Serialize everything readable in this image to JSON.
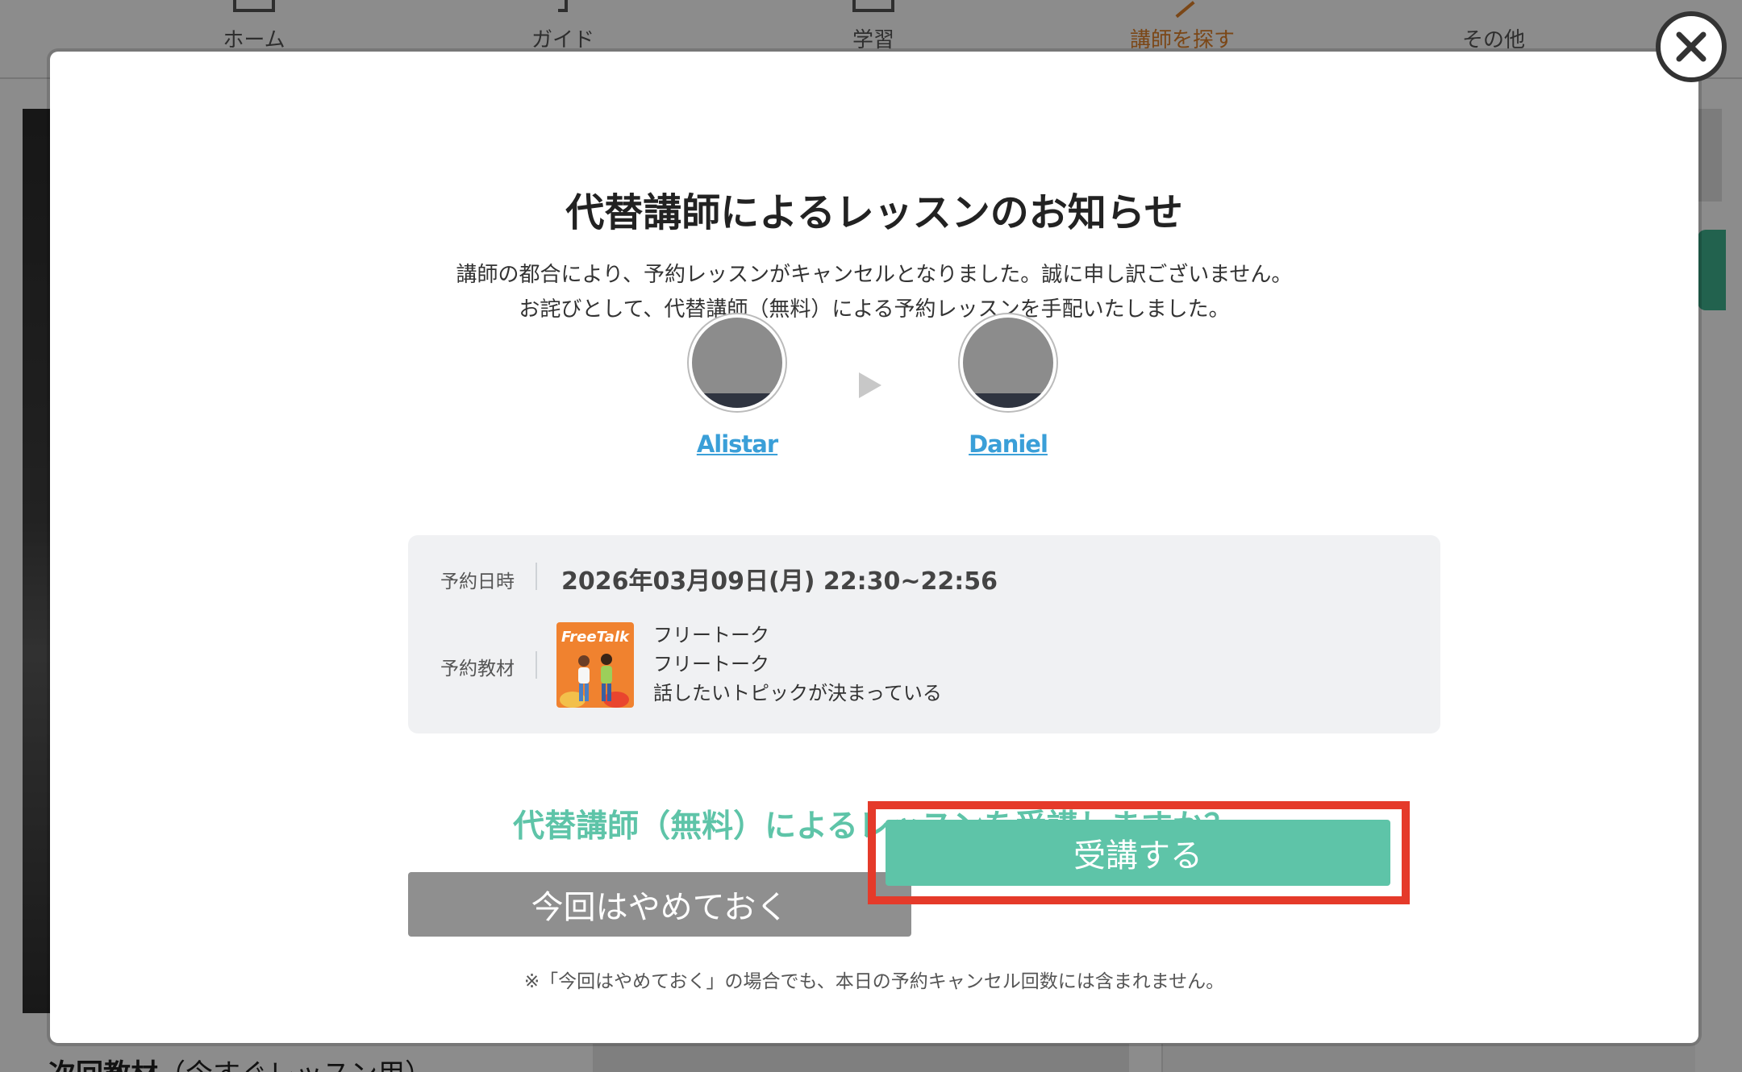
{
  "nav": {
    "items": [
      {
        "label": "ホーム",
        "icon": "home-icon"
      },
      {
        "label": "ガイド",
        "icon": "guide-icon"
      },
      {
        "label": "学習",
        "icon": "study-icon"
      },
      {
        "label": "講師を探す",
        "icon": "search-tutor-icon",
        "active": true
      },
      {
        "label": "その他",
        "icon": "more-icon"
      }
    ]
  },
  "background": {
    "bottom_title": "次回教材",
    "bottom_sub": "（今すぐレッスン用）"
  },
  "modal": {
    "title": "代替講師によるレッスンのお知らせ",
    "desc_line1": "講師の都合により、予約レッスンがキャンセルとなりました。誠に申し訳ございません。",
    "desc_line2": "お詫びとして、代替講師（無料）による予約レッスンを手配いたしました。",
    "original_tutor": "Alistar",
    "substitute_tutor": "Daniel",
    "booking": {
      "datetime_label": "予約日時",
      "datetime_value": "2026年03月09日(月) 22:30~22:56",
      "material_label": "予約教材",
      "material_thumb_text": "FreeTalk",
      "material_lines": [
        "フリートーク",
        "フリートーク",
        "話したいトピックが決まっている"
      ]
    },
    "question": "代替講師（無料）によるレッスンを受講しますか？",
    "decline_button": "今回はやめておく",
    "accept_button": "受講する",
    "note": "※「今回はやめておく」の場合でも、本日の予約キャンセル回数には含まれません。"
  },
  "colors": {
    "accent_green": "#5ec4a8",
    "link_blue": "#3a9fd8",
    "decline_gray": "#8f8f8f",
    "highlight_red": "#e53a2a",
    "nav_active": "#e0822b"
  }
}
